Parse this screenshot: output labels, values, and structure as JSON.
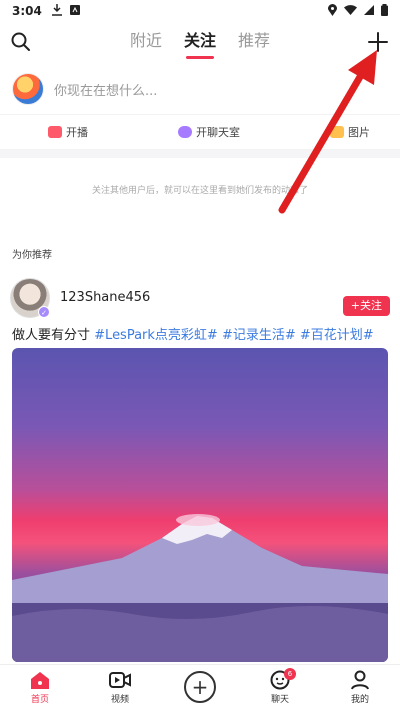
{
  "status_bar": {
    "time": "3:04"
  },
  "top_nav": {
    "tabs": [
      {
        "label": "附近",
        "active": false
      },
      {
        "label": "关注",
        "active": true
      },
      {
        "label": "推荐",
        "active": false
      }
    ],
    "accent_color": "#f0334f"
  },
  "compose": {
    "placeholder": "你现在在想什么..."
  },
  "quick_actions": [
    {
      "label": "开播",
      "icon": "live-icon"
    },
    {
      "label": "开聊天室",
      "icon": "chatroom-icon"
    },
    {
      "label": "图片",
      "icon": "image-icon"
    }
  ],
  "follow_hint": "关注其他用户后，就可以在这里看到她们发布的动态了",
  "recommend_section": {
    "title": "为你推荐"
  },
  "post": {
    "username": "123Shane456",
    "follow_label": "+关注",
    "text_plain": "做人要有分寸",
    "tags": [
      "#LesPark点亮彩虹#",
      "#记录生活#",
      "#百花计划#"
    ]
  },
  "bottom_nav": {
    "items": [
      {
        "label": "首页",
        "icon": "home-icon",
        "active": true
      },
      {
        "label": "视频",
        "icon": "video-icon",
        "active": false
      },
      {
        "label": "",
        "icon": "create-plus-icon",
        "active": false
      },
      {
        "label": "聊天",
        "icon": "chat-icon",
        "active": false,
        "badge": "6"
      },
      {
        "label": "我的",
        "icon": "profile-icon",
        "active": false
      }
    ]
  }
}
